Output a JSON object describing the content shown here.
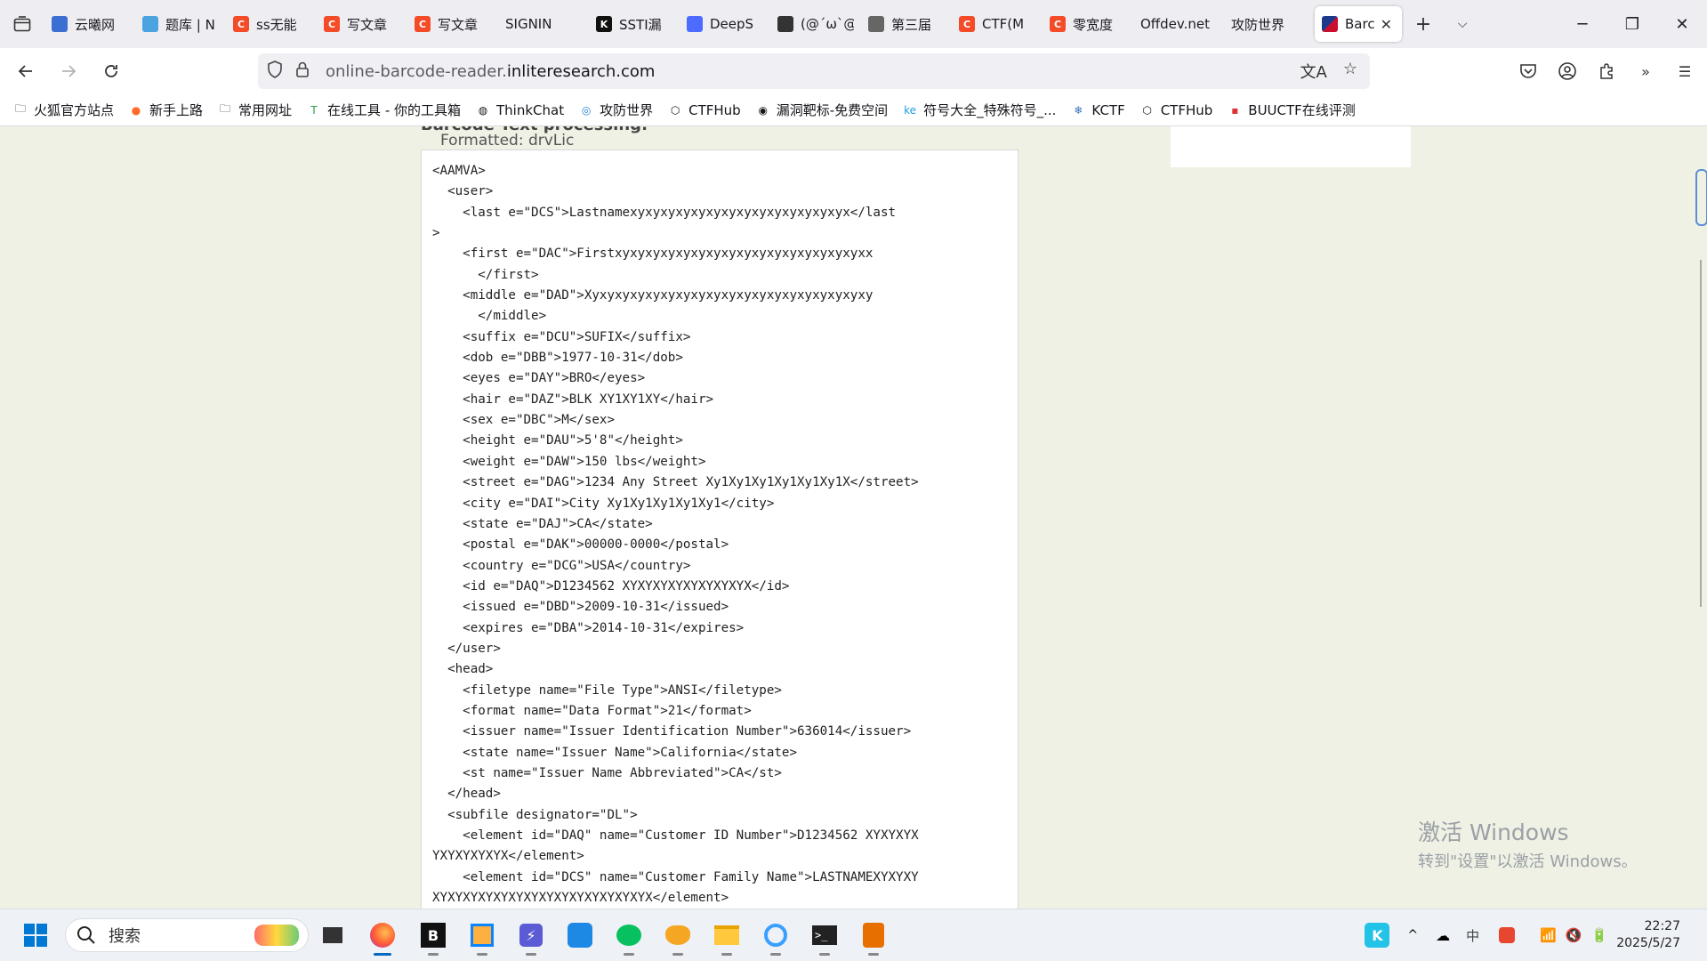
{
  "tabs": [
    {
      "label": "云曦网",
      "icon": "globe-icon",
      "color": "#3b6fd1"
    },
    {
      "label": "题库 | N",
      "icon": "cloud-icon",
      "color": "#4ca3e0"
    },
    {
      "label": "ss无能",
      "icon": "csdn-icon",
      "color": "#f44b28"
    },
    {
      "label": "写文章",
      "icon": "csdn-icon",
      "color": "#f44b28"
    },
    {
      "label": "写文章",
      "icon": "csdn-icon",
      "color": "#f44b28"
    },
    {
      "label": "SIGNIN",
      "icon": "blank-icon",
      "color": "#eeeef2"
    },
    {
      "label": "SSTI漏",
      "icon": "k-icon",
      "color": "#111111"
    },
    {
      "label": "DeepS",
      "icon": "deepseek-icon",
      "color": "#4d6bfe"
    },
    {
      "label": "(@´ω`@",
      "icon": "avatar-icon",
      "color": "#333333"
    },
    {
      "label": "第三届",
      "icon": "mic-icon",
      "color": "#666666"
    },
    {
      "label": "CTF(M",
      "icon": "csdn-icon",
      "color": "#f44b28"
    },
    {
      "label": "零宽度",
      "icon": "csdn-icon",
      "color": "#f44b28"
    },
    {
      "label": "Offdev.net",
      "icon": "blank-icon",
      "color": "#eeeef2"
    },
    {
      "label": "攻防世界",
      "icon": "blank-icon",
      "color": "#eeeef2"
    }
  ],
  "active_tab": {
    "label": "Barc",
    "icon": "barcode-flag-icon"
  },
  "url": {
    "prefix": "online-barcode-reader.",
    "domain": "inliteresearch.com"
  },
  "bookmarks": [
    {
      "label": "火狐官方站点",
      "icon": "folder-icon"
    },
    {
      "label": "新手上路",
      "icon": "firefox-icon"
    },
    {
      "label": "常用网址",
      "icon": "folder-icon"
    },
    {
      "label": "在线工具 - 你的工具箱",
      "icon": "tool-icon"
    },
    {
      "label": "ThinkChat",
      "icon": "globe-icon"
    },
    {
      "label": "攻防世界",
      "icon": "swirl-icon"
    },
    {
      "label": "CTFHub",
      "icon": "hex-icon"
    },
    {
      "label": "漏洞靶标-免费空间",
      "icon": "target-icon"
    },
    {
      "label": "符号大全_特殊符号_...",
      "icon": "ke-icon"
    },
    {
      "label": "KCTF",
      "icon": "snowflake-icon"
    },
    {
      "label": "CTFHub",
      "icon": "hex-icon"
    },
    {
      "label": "BUUCTF在线评测",
      "icon": "buu-icon"
    }
  ],
  "page": {
    "section_title": "Barcode Text processing:",
    "formatted": "Formatted: drvLic",
    "code": "<AAMVA>\n  <user>\n    <last e=\"DCS\">Lastnamexyxyxyxyxyxyxyxyxyxyxyxyxyxyx</last\n>\n    <first e=\"DAC\">Firstxyxyxyxyxyxyxyxyxyxyxyxyxyxyxyxyxx\n      </first>\n    <middle e=\"DAD\">Xyxyxyxyxyxyxyxyxyxyxyxyxyxyxyxyxyxyxy\n      </middle>\n    <suffix e=\"DCU\">SUFIX</suffix>\n    <dob e=\"DBB\">1977-10-31</dob>\n    <eyes e=\"DAY\">BRO</eyes>\n    <hair e=\"DAZ\">BLK XY1XY1XY</hair>\n    <sex e=\"DBC\">M</sex>\n    <height e=\"DAU\">5'8\"</height>\n    <weight e=\"DAW\">150 lbs</weight>\n    <street e=\"DAG\">1234 Any Street Xy1Xy1Xy1Xy1Xy1Xy1X</street>\n    <city e=\"DAI\">City Xy1Xy1Xy1Xy1Xy1</city>\n    <state e=\"DAJ\">CA</state>\n    <postal e=\"DAK\">00000-0000</postal>\n    <country e=\"DCG\">USA</country>\n    <id e=\"DAQ\">D1234562 XYXYXYXYXYXYXYXYX</id>\n    <issued e=\"DBD\">2009-10-31</issued>\n    <expires e=\"DBA\">2014-10-31</expires>\n  </user>\n  <head>\n    <filetype name=\"File Type\">ANSI</filetype>\n    <format name=\"Data Format\">21</format>\n    <issuer name=\"Issuer Identification Number\">636014</issuer>\n    <state name=\"Issuer Name\">California</state>\n    <st name=\"Issuer Name Abbreviated\">CA</st>\n  </head>\n  <subfile designator=\"DL\">\n    <element id=\"DAQ\" name=\"Customer ID Number\">D1234562 XYXYXYX\nYXYXYXYXYX</element>\n    <element id=\"DCS\" name=\"Customer Family Name\">LASTNAMEXYXYXY\nXYXYXYXYXYXYXYXYXYXYXYXYXYXYX</element>"
  },
  "watermark": {
    "line1": "激活 Windows",
    "line2": "转到\"设置\"以激活 Windows。"
  },
  "taskbar": {
    "search_placeholder": "搜索",
    "time": "22:27",
    "date": "2025/5/27",
    "ime": "中",
    "colors": {
      "accent": "#0067c0"
    }
  }
}
